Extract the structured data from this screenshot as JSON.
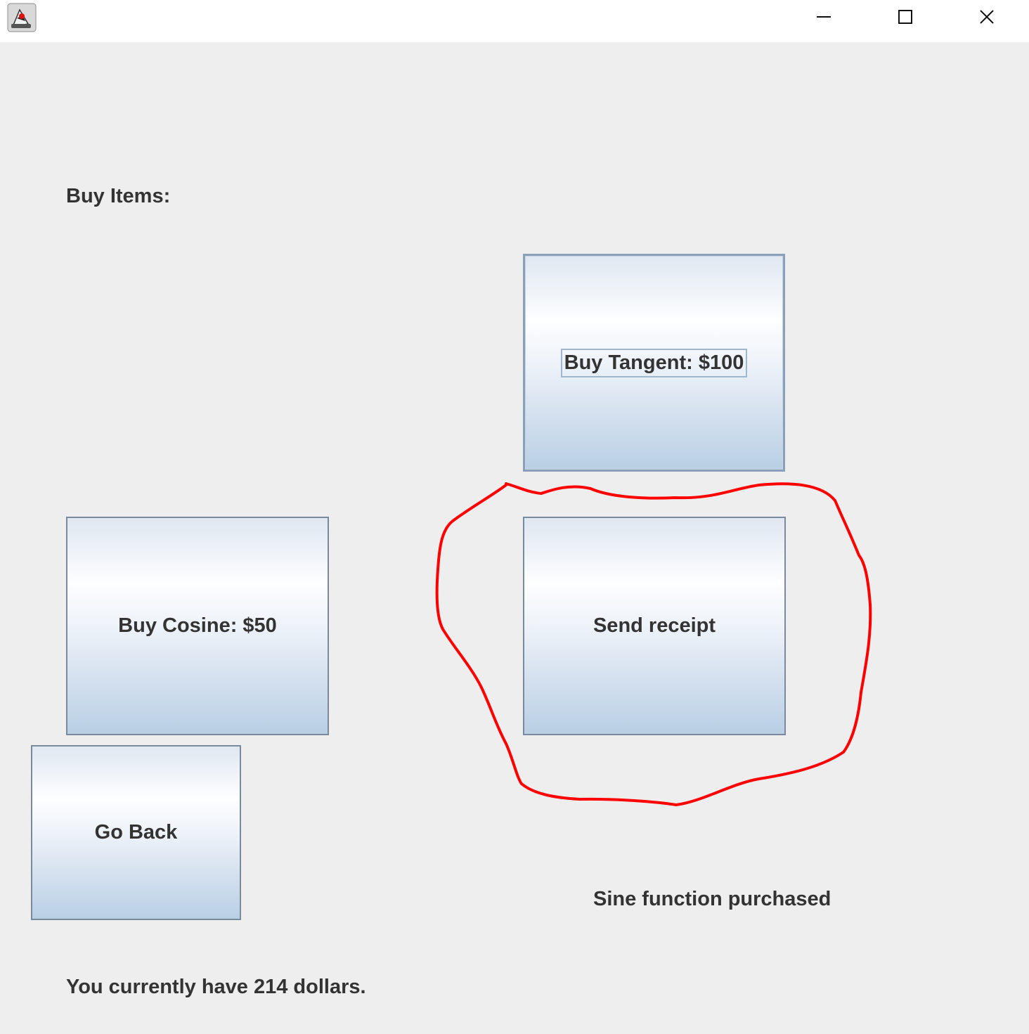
{
  "window": {
    "icon": "java-duke-icon",
    "controls": {
      "minimize": "minimize-icon",
      "maximize": "maximize-icon",
      "close": "close-icon"
    }
  },
  "shop": {
    "heading": "Buy Items:",
    "buttons": {
      "buy_tangent": "Buy Tangent: $100",
      "buy_cosine": "Buy Cosine: $50",
      "send_receipt": "Send receipt",
      "go_back": "Go Back"
    },
    "status_message": "Sine function purchased",
    "balance_text": "You currently have 214 dollars."
  },
  "colors": {
    "background": "#eeeeee",
    "text": "#333333",
    "annotation": "#ff0000"
  }
}
